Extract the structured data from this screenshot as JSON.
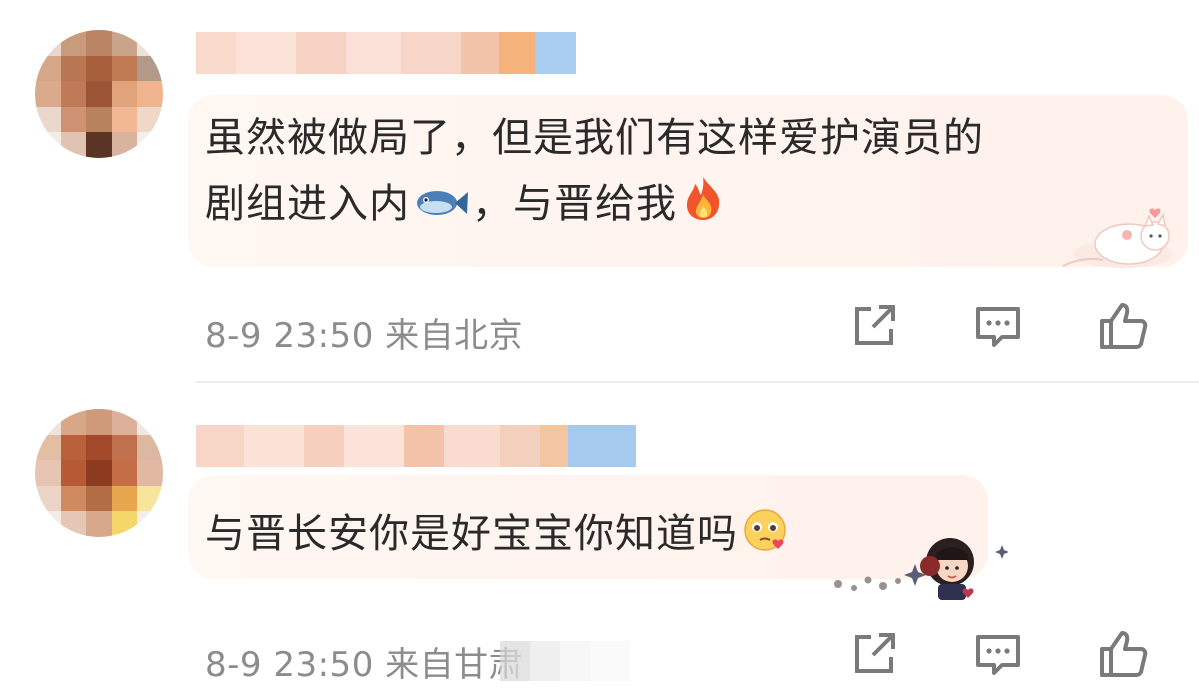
{
  "comments": [
    {
      "text_line1": "虽然被做局了，但是我们有这样爱护演员的",
      "text_line2a": "剧组进入内",
      "text_line2b": "，与晋给我",
      "emoji_fish": "fish-emoji",
      "emoji_fire": "fire-emoji",
      "meta": "8-9 23:50 来自北京",
      "icons": [
        "share-icon",
        "comment-icon",
        "like-icon"
      ]
    },
    {
      "text": "与晋长安你是好宝宝你知道吗",
      "emoji_face": "pleading-face-emoji",
      "meta": "8-9 23:50 来自甘肃",
      "icons": [
        "share-icon",
        "comment-icon",
        "like-icon"
      ]
    }
  ],
  "colors": {
    "bubble": "#fff3ee",
    "meta_text": "#8c8c8c",
    "icon": "#7a7a7a",
    "divider": "#eeeeee"
  }
}
